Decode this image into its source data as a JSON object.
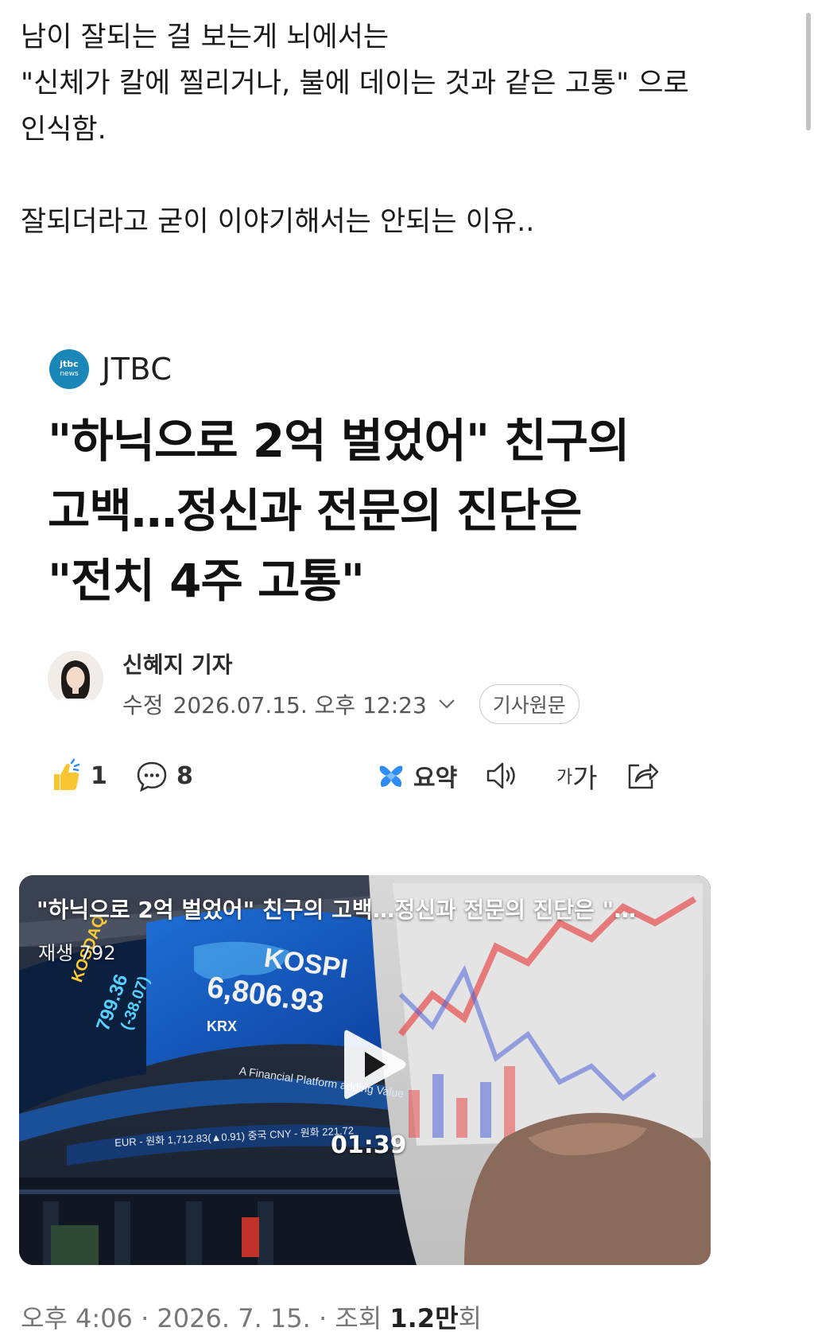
{
  "post": {
    "line1": "남이 잘되는 걸 보는게 뇌에서는",
    "line2": "\"신체가 칼에 찔리거나, 불에 데이는 것과 같은 고통\" 으로",
    "line3": "인식함.",
    "line4": "잘되더라고 굳이 이야기해서는 안되는 이유.."
  },
  "article": {
    "publisher": "JTBC",
    "publisher_logo_top": "jtbc",
    "publisher_logo_bottom": "news",
    "headline_line1": "\"하닉으로 2억 벌었어\" 친구의",
    "headline_line2": "고백…정신과 전문의 진단은",
    "headline_line3": "\"전치 4주 고통\"",
    "reporter": "신혜지 기자",
    "edited_label": "수정",
    "edited_datetime": "2026.07.15. 오후 12:23",
    "original_button": "기사원문"
  },
  "actions": {
    "like_count": "1",
    "comment_count": "8",
    "summary_label": "요약",
    "fontsize_small": "가",
    "fontsize_large": "가"
  },
  "video": {
    "title": "\"하닉으로 2억 벌었어\" 친구의 고백…정신과 전문의 진단은 \"…",
    "views": "재생 792",
    "duration": "01:39",
    "screen_kospi": "KOSPI",
    "screen_kospi_value": "6,806.93",
    "screen_kosdaq": "KOSDAQ",
    "screen_kosdaq_value": "799.36",
    "screen_kosdaq_change": "(-38.07)",
    "screen_krx": "KRX",
    "screen_banner": "A Financial Platform adding Value",
    "screen_ticker": "EUR - 원화 1,712.83(▲0.91)  중국 CNY - 원화 221.72"
  },
  "footer": {
    "time": "오후 4:06 · 2026. 7. 15. · 조회",
    "views_number": "1.2만",
    "views_unit": "회"
  },
  "colors": {
    "accent_blue": "#1b86b8",
    "summary_icon_blue": "#2f8cf5",
    "like_yellow": "#f7c531"
  }
}
